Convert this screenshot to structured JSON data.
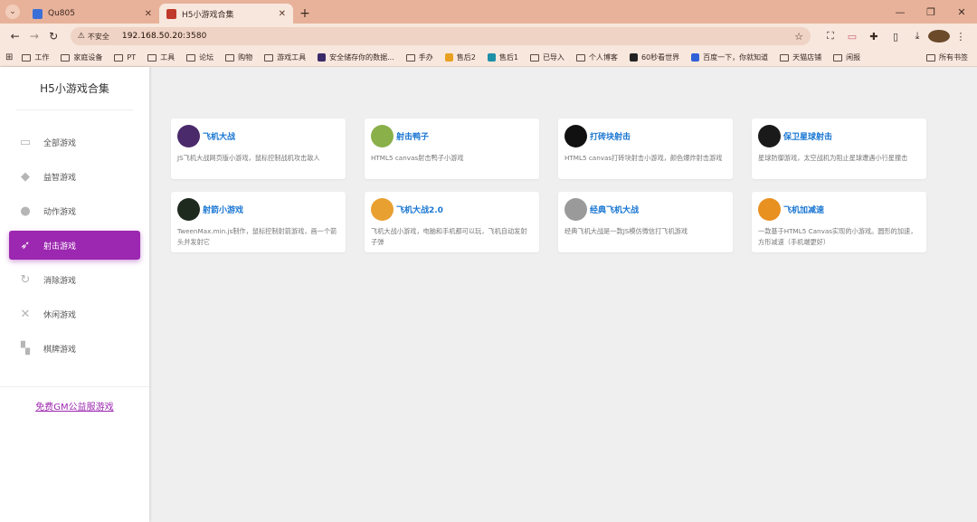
{
  "browser": {
    "tabs": [
      {
        "title": "Qu805",
        "favicon_color": "#3b6fd8",
        "active": false
      },
      {
        "title": "H5小游戏合集",
        "favicon_color": "#c0392b",
        "active": true
      }
    ],
    "new_tab": "+",
    "url": {
      "security_label": "不安全",
      "host": "192.168.50.20",
      "port": ":3580"
    },
    "bookmarks": [
      {
        "label": "工作",
        "type": "folder"
      },
      {
        "label": "家庭设备",
        "type": "folder"
      },
      {
        "label": "PT",
        "type": "folder"
      },
      {
        "label": "工具",
        "type": "folder"
      },
      {
        "label": "论坛",
        "type": "folder"
      },
      {
        "label": "购物",
        "type": "folder"
      },
      {
        "label": "游戏工具",
        "type": "folder"
      },
      {
        "label": "安全储存你的数据...",
        "type": "site",
        "color": "#3a2a6a"
      },
      {
        "label": "手办",
        "type": "folder"
      },
      {
        "label": "售后2",
        "type": "site",
        "color": "#e8a020"
      },
      {
        "label": "售后1",
        "type": "site",
        "color": "#1e90a8"
      },
      {
        "label": "已导入",
        "type": "folder"
      },
      {
        "label": "个人博客",
        "type": "folder"
      },
      {
        "label": "60秒看世界",
        "type": "site",
        "color": "#222222"
      },
      {
        "label": "百度一下，你就知道",
        "type": "site",
        "color": "#3060d8"
      },
      {
        "label": "天猫店铺",
        "type": "folder"
      },
      {
        "label": "闲报",
        "type": "folder"
      }
    ],
    "all_bookmarks": "所有书签"
  },
  "sidebar": {
    "title": "H5小游戏合集",
    "items": [
      {
        "label": "全部游戏",
        "icon": "twitch-icon",
        "glyph": "▭",
        "active": false
      },
      {
        "label": "益智游戏",
        "icon": "graduation-cap-icon",
        "glyph": "◆",
        "active": false
      },
      {
        "label": "动作游戏",
        "icon": "reddit-icon",
        "glyph": "●",
        "active": false
      },
      {
        "label": "射击游戏",
        "icon": "rocket-icon",
        "glyph": "➶",
        "active": true
      },
      {
        "label": "消除游戏",
        "icon": "refresh-icon",
        "glyph": "↻",
        "active": false
      },
      {
        "label": "休闲游戏",
        "icon": "gamepad-icon",
        "glyph": "✕",
        "active": false
      },
      {
        "label": "棋牌游戏",
        "icon": "chessboard-icon",
        "glyph": "▚",
        "active": false
      }
    ],
    "gm_link": "免费GM公益服游戏"
  },
  "games": [
    {
      "title": "飞机大战",
      "desc": "JS飞机大战网页版小游戏，鼠标控制战机攻击敌人",
      "icon": "plane-war-icon",
      "color": "#4a2a6a"
    },
    {
      "title": "射击鸭子",
      "desc": "HTML5 canvas射击鸭子小游戏",
      "icon": "duck-icon",
      "color": "#8ab04a"
    },
    {
      "title": "打砖块射击",
      "desc": "HTML5 canvas打砖块射击小游戏，颜色爆炸射击游戏",
      "icon": "brick-icon",
      "color": "#111111"
    },
    {
      "title": "保卫星球射击",
      "desc": "星球防御游戏，太空战机为阻止星球遭遇小行星撞击",
      "icon": "planet-icon",
      "color": "#1a1a1a"
    },
    {
      "title": "射箭小游戏",
      "desc": "TweenMax.min.js制作，鼠标控制射箭游戏，画一个箭头并发射它",
      "icon": "archery-icon",
      "color": "#1f2a1f"
    },
    {
      "title": "飞机大战2.0",
      "desc": "飞机大战小游戏，电脑和手机都可以玩，飞机自动发射子弹",
      "icon": "plane-war2-icon",
      "color": "#e8a030"
    },
    {
      "title": "经典飞机大战",
      "desc": "经典飞机大战是一款JS模仿微信打飞机游戏",
      "icon": "classic-plane-icon",
      "color": "#9a9a9a"
    },
    {
      "title": "飞机加减速",
      "desc": "一款基于HTML5 Canvas实现的小游戏。圆形的加速，方形减速（手机端更好）",
      "icon": "plane-speed-icon",
      "color": "#e89020"
    }
  ]
}
